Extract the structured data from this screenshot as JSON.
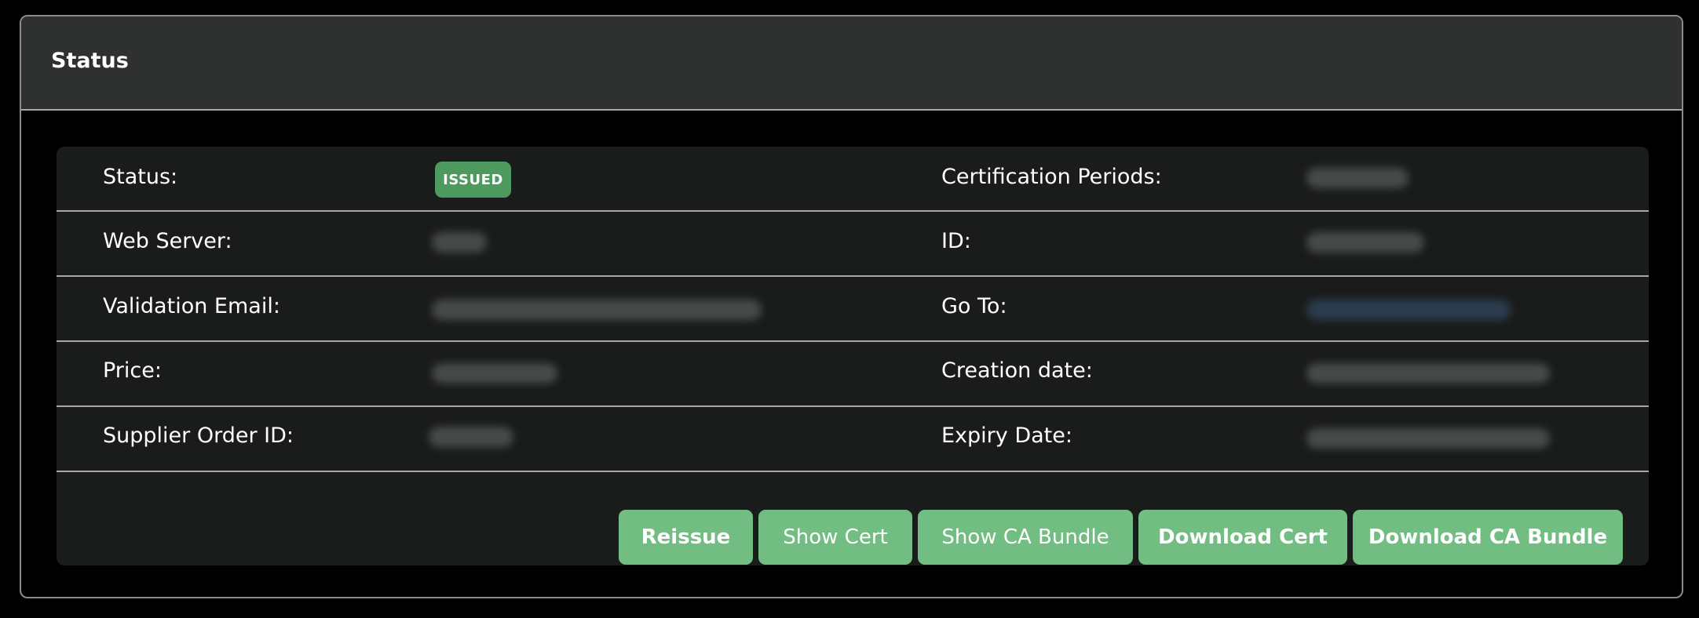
{
  "card": {
    "title": "Status"
  },
  "details": {
    "left": [
      {
        "label": "Status:",
        "badge": "ISSUED"
      },
      {
        "label": "Web Server:"
      },
      {
        "label": "Validation Email:"
      },
      {
        "label": "Price:"
      },
      {
        "label": "Supplier Order ID:"
      }
    ],
    "right": [
      {
        "label": "Certification Periods:"
      },
      {
        "label": "ID:"
      },
      {
        "label": "Go To:"
      },
      {
        "label": "Creation date:"
      },
      {
        "label": "Expiry Date:"
      }
    ]
  },
  "actions": {
    "reissue": "Reissue",
    "show_cert": "Show Cert",
    "show_ca_bundle": "Show CA Bundle",
    "download_cert": "Download Cert",
    "download_ca_bundle": "Download CA Bundle"
  },
  "colors": {
    "badge": "#4e9a5e",
    "button": "#72bd82",
    "header": "#2f3130",
    "panel": "#1a1c1b"
  }
}
